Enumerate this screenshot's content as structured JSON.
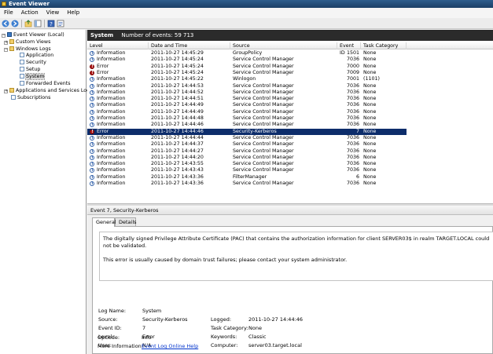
{
  "window": {
    "title": "Event Viewer"
  },
  "menu": [
    "File",
    "Action",
    "View",
    "Help"
  ],
  "tree": {
    "items": [
      {
        "label": "Event Viewer (Local)",
        "icon": "event-viewer-icon",
        "expander": "-"
      },
      {
        "label": "Custom Views",
        "icon": "folder-icon",
        "expander": "+"
      },
      {
        "label": "Windows Logs",
        "icon": "folder-icon",
        "expander": "-"
      },
      {
        "label": "Application",
        "icon": "log-icon",
        "expander": ""
      },
      {
        "label": "Security",
        "icon": "log-icon",
        "expander": ""
      },
      {
        "label": "Setup",
        "icon": "log-icon",
        "expander": ""
      },
      {
        "label": "System",
        "icon": "log-icon",
        "expander": "",
        "selected": true
      },
      {
        "label": "Forwarded Events",
        "icon": "log-icon",
        "expander": ""
      },
      {
        "label": "Applications and Services Logs",
        "icon": "folder-icon",
        "expander": "+"
      },
      {
        "label": "Subscriptions",
        "icon": "log-icon",
        "expander": ""
      }
    ]
  },
  "list": {
    "log_name": "System",
    "count_text": "Number of events: 59 713",
    "columns": [
      "Level",
      "Date and Time",
      "Source",
      "Event ID",
      "Task Category"
    ],
    "rows": [
      {
        "level": "Information",
        "datetime": "2011-10-27 14:45:29",
        "source": "GroupPolicy",
        "event_id": "1501",
        "category": "None"
      },
      {
        "level": "Information",
        "datetime": "2011-10-27 14:45:24",
        "source": "Service Control Manager",
        "event_id": "7036",
        "category": "None"
      },
      {
        "level": "Error",
        "datetime": "2011-10-27 14:45:24",
        "source": "Service Control Manager",
        "event_id": "7000",
        "category": "None"
      },
      {
        "level": "Error",
        "datetime": "2011-10-27 14:45:24",
        "source": "Service Control Manager",
        "event_id": "7009",
        "category": "None"
      },
      {
        "level": "Information",
        "datetime": "2011-10-27 14:45:22",
        "source": "Winlogon",
        "event_id": "7001",
        "category": "(1101)"
      },
      {
        "level": "Information",
        "datetime": "2011-10-27 14:44:53",
        "source": "Service Control Manager",
        "event_id": "7036",
        "category": "None"
      },
      {
        "level": "Information",
        "datetime": "2011-10-27 14:44:52",
        "source": "Service Control Manager",
        "event_id": "7036",
        "category": "None"
      },
      {
        "level": "Information",
        "datetime": "2011-10-27 14:44:51",
        "source": "Service Control Manager",
        "event_id": "7036",
        "category": "None"
      },
      {
        "level": "Information",
        "datetime": "2011-10-27 14:44:49",
        "source": "Service Control Manager",
        "event_id": "7036",
        "category": "None"
      },
      {
        "level": "Information",
        "datetime": "2011-10-27 14:44:49",
        "source": "Service Control Manager",
        "event_id": "7036",
        "category": "None"
      },
      {
        "level": "Information",
        "datetime": "2011-10-27 14:44:48",
        "source": "Service Control Manager",
        "event_id": "7036",
        "category": "None"
      },
      {
        "level": "Information",
        "datetime": "2011-10-27 14:44:46",
        "source": "Service Control Manager",
        "event_id": "7036",
        "category": "None"
      },
      {
        "level": "Error",
        "datetime": "2011-10-27 14:44:46",
        "source": "Security-Kerberos",
        "event_id": "7",
        "category": "None",
        "selected": true
      },
      {
        "level": "Information",
        "datetime": "2011-10-27 14:44:44",
        "source": "Service Control Manager",
        "event_id": "7036",
        "category": "None"
      },
      {
        "level": "Information",
        "datetime": "2011-10-27 14:44:37",
        "source": "Service Control Manager",
        "event_id": "7036",
        "category": "None"
      },
      {
        "level": "Information",
        "datetime": "2011-10-27 14:44:27",
        "source": "Service Control Manager",
        "event_id": "7036",
        "category": "None"
      },
      {
        "level": "Information",
        "datetime": "2011-10-27 14:44:20",
        "source": "Service Control Manager",
        "event_id": "7036",
        "category": "None"
      },
      {
        "level": "Information",
        "datetime": "2011-10-27 14:43:55",
        "source": "Service Control Manager",
        "event_id": "7036",
        "category": "None"
      },
      {
        "level": "Information",
        "datetime": "2011-10-27 14:43:43",
        "source": "Service Control Manager",
        "event_id": "7036",
        "category": "None"
      },
      {
        "level": "Information",
        "datetime": "2011-10-27 14:43:36",
        "source": "FilterManager",
        "event_id": "6",
        "category": "None"
      },
      {
        "level": "Information",
        "datetime": "2011-10-27 14:43:36",
        "source": "Service Control Manager",
        "event_id": "7036",
        "category": "None"
      }
    ]
  },
  "detail": {
    "header": "Event 7, Security-Kerberos",
    "tabs": [
      "General",
      "Details"
    ],
    "description": [
      "The digitally signed Privilege Attribute Certificate (PAC) that contains the authorization information for client SERVER03$ in realm TARGET.LOCAL could not be validated.",
      "This error is usually caused by domain trust failures; please contact your system administrator."
    ],
    "fields": {
      "log_name_label": "Log Name:",
      "log_name": "System",
      "source_label": "Source:",
      "source": "Security-Kerberos",
      "logged_label": "Logged:",
      "logged": "2011-10-27 14:44:46",
      "event_id_label": "Event ID:",
      "event_id": "7",
      "task_category_label": "Task Category:",
      "task_category": "None",
      "level_label": "Level:",
      "level": "Error",
      "keywords_label": "Keywords:",
      "keywords": "Classic",
      "user_label": "User:",
      "user": "N/A",
      "computer_label": "Computer:",
      "computer": "server03.target.local",
      "opcode_label": "OpCode:",
      "opcode": "Info",
      "more_info_label": "More Information:",
      "more_info_link": "Event Log Online Help"
    }
  }
}
